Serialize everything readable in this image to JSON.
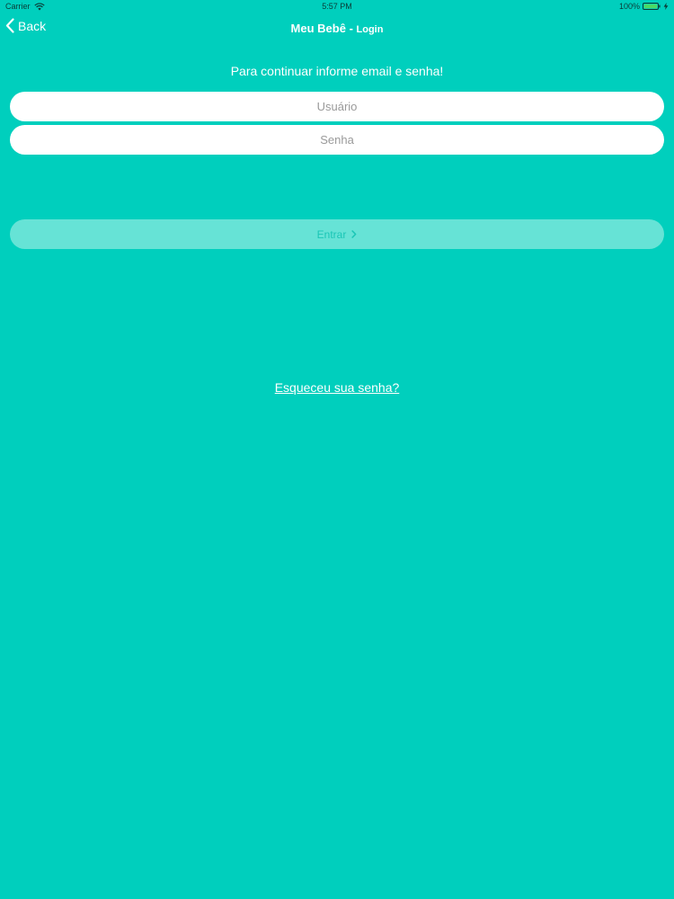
{
  "status_bar": {
    "carrier": "Carrier",
    "time": "5:57 PM",
    "battery": "100%"
  },
  "nav": {
    "back_label": "Back",
    "title_main": "Meu Bebê",
    "title_sep": " - ",
    "title_sub": "Login"
  },
  "login": {
    "instruction": "Para continuar informe email e senha!",
    "user_placeholder": "Usuário",
    "password_placeholder": "Senha",
    "enter_label": "Entrar",
    "forgot_label": "Esqueceu sua senha?"
  },
  "colors": {
    "background": "#00cfbd",
    "button_disabled": "#66e3d6",
    "button_text": "#1bc6b6",
    "battery": "#4cd964"
  },
  "icons": {
    "wifi": "wifi-icon",
    "battery": "battery-icon",
    "charging": "bolt-icon",
    "back": "chevron-left-icon",
    "enter": "chevron-right-icon"
  }
}
